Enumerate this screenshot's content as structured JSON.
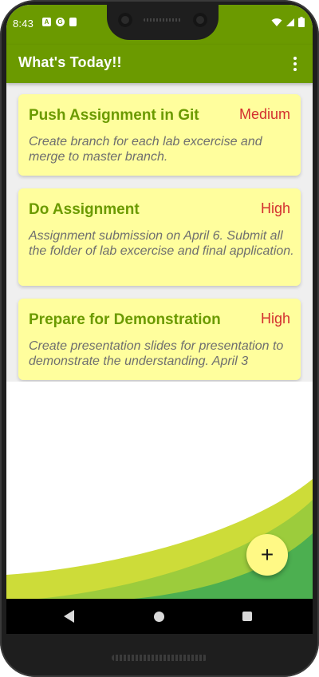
{
  "status_bar": {
    "time": "8:43",
    "left_icons": [
      "A",
      "G",
      "SD"
    ],
    "right_icons": [
      "wifi-icon",
      "signal-icon",
      "battery-icon"
    ]
  },
  "app_bar": {
    "title": "What's Today!!",
    "menu_icon": "more-vert-icon"
  },
  "tasks": [
    {
      "title": "Push Assignment in Git",
      "priority": "Medium",
      "description": "Create branch for each lab excercise and merge to master branch."
    },
    {
      "title": "Do Assignment",
      "priority": "High",
      "description": "Assignment submission on April 6. Submit all the folder of lab excercise and final application."
    },
    {
      "title": "Prepare for Demonstration",
      "priority": "High",
      "description": "Create presentation slides for presentation to demonstrate the understanding. April 3"
    }
  ],
  "fab": {
    "label": "+",
    "icon": "add-icon"
  },
  "nav": {
    "back_icon": "back-icon",
    "home_icon": "home-icon",
    "recents_icon": "recents-icon"
  },
  "colors": {
    "primary": "#6b9a00",
    "card_background": "#fffe9d",
    "priority_text": "#d32f2f",
    "fab_background": "#fff985"
  }
}
